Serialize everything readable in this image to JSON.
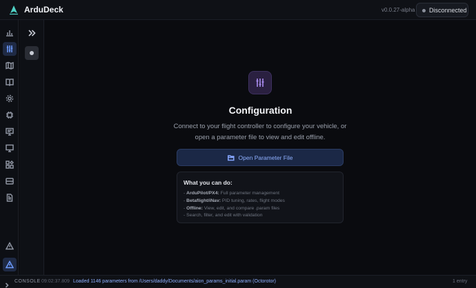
{
  "app": {
    "title": "ArduDeck",
    "version": "v0.0.27-alpha",
    "status": "Disconnected"
  },
  "rail": {
    "icons": [
      "chart-icon",
      "sliders-icon",
      "map-icon",
      "book-icon",
      "gear-icon",
      "chip-icon",
      "monitor-icon",
      "display-icon",
      "puzzle-icon",
      "drive-icon",
      "file-icon",
      "warning-icon",
      "alert-icon"
    ],
    "active": "sliders-icon"
  },
  "main": {
    "heading": "Configuration",
    "description": "Connect to your flight controller to configure your vehicle, or open a parameter file to view and edit offline.",
    "open_button": "Open Parameter File",
    "card": {
      "title": "What you can do:",
      "items": [
        {
          "bullet": "- ",
          "strong": "ArduPilot/PX4:",
          "text": " Full parameter management"
        },
        {
          "bullet": "- ",
          "strong": "Betaflight/iNav:",
          "text": " PID tuning, rates, flight modes"
        },
        {
          "bullet": "- ",
          "strong": "Offline:",
          "text": " View, edit, and compare .param files"
        },
        {
          "bullet": "- ",
          "strong": "",
          "text": "Search, filter, and edit with validation"
        }
      ]
    }
  },
  "console": {
    "label": "CONSOLE",
    "time": "09:02:37.809",
    "message": "Loaded 1146 parameters from /Users/daddy/Documents/aion_params_initial.param (Octorotor)",
    "count": "1 entry"
  },
  "colors": {
    "accent": "#6d9bff",
    "hero": "#a98cf0",
    "background": "#0a0b0f"
  }
}
